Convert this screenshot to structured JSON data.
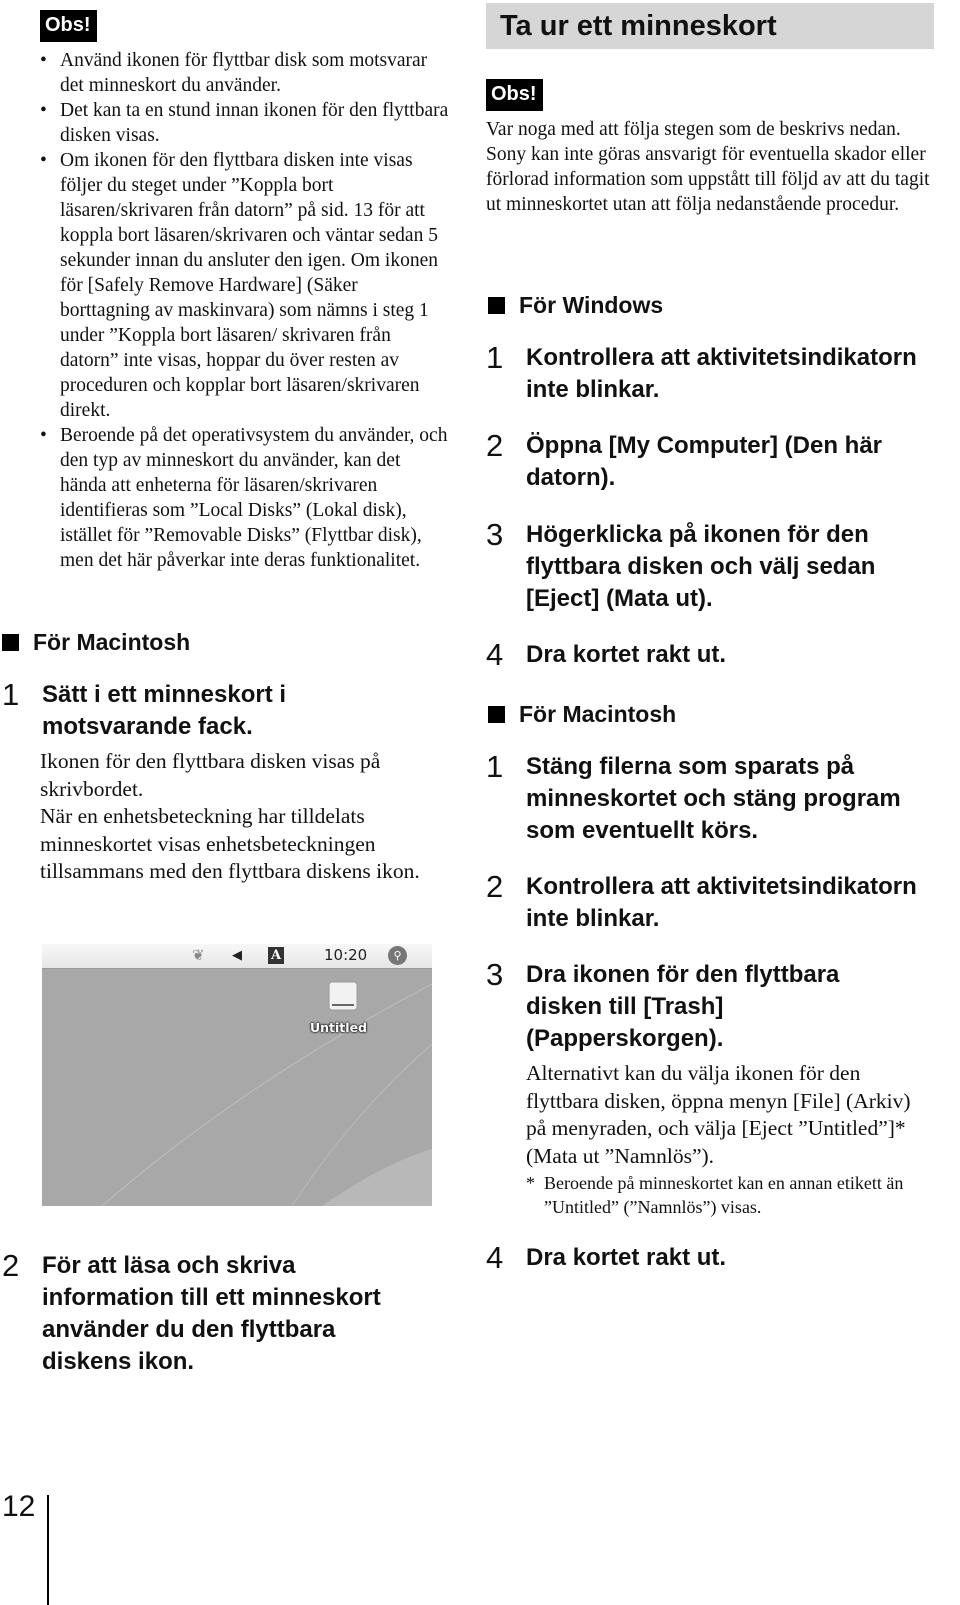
{
  "left": {
    "obs_label": "Obs!",
    "bullets": [
      "Använd ikonen för flyttbar disk som motsvarar det minneskort du använder.",
      "Det kan ta en stund innan ikonen för den flyttbara disken visas.",
      "Om ikonen för den flyttbara disken inte visas följer du steget under ”Koppla bort läsaren/skrivaren från datorn” på sid. 13 för att koppla bort läsaren/skrivaren och väntar sedan 5 sekunder innan du ansluter den igen. Om ikonen för [Safely Remove Hardware] (Säker borttagning av maskinvara) som nämns i steg 1 under ”Koppla bort läsaren/ skrivaren från datorn” inte visas, hoppar du över resten av proceduren och kopplar bort läsaren/skrivaren direkt.",
      "Beroende på det operativsystem du använder, och den typ av minneskort du använder, kan det hända att enheterna för läsaren/skrivaren identifieras som ”Local Disks” (Lokal disk), istället för ”Removable Disks” (Flyttbar disk), men det här påverkar inte deras funktionalitet."
    ],
    "mac_heading": "För Macintosh",
    "steps": [
      {
        "num": "1",
        "text": "Sätt i ett minneskort i motsvarande fack.",
        "body": "Ikonen för den flyttbara disken visas på skrivbordet.\nNär en enhetsbeteckning har tilldelats minneskortet visas enhetsbeteckningen tillsammans med den flyttbara diskens ikon."
      },
      {
        "num": "2",
        "text": "För att läsa och skriva information till ett minneskort använder du den flyttbara diskens ikon."
      }
    ],
    "screenshot": {
      "menubar_time": "10:20",
      "drive_label": "Untitled"
    }
  },
  "right": {
    "title": "Ta ur ett minneskort",
    "obs_label": "Obs!",
    "obs_text": "Var noga med att följa stegen som de beskrivs nedan.\nSony kan inte göras ansvarigt för eventuella skador eller förlorad information som uppstått till följd av att du tagit ut minneskortet utan att följa nedanstående procedur.",
    "windows_heading": "För Windows",
    "windows_steps": [
      {
        "num": "1",
        "text": "Kontrollera att aktivitetsindikatorn inte blinkar."
      },
      {
        "num": "2",
        "text": "Öppna [My Computer] (Den här datorn)."
      },
      {
        "num": "3",
        "text": "Högerklicka på ikonen för den flyttbara disken och välj sedan [Eject] (Mata ut)."
      },
      {
        "num": "4",
        "text": "Dra kortet rakt ut."
      }
    ],
    "mac_heading": "För Macintosh",
    "mac_steps": [
      {
        "num": "1",
        "text": "Stäng filerna som sparats på minneskortet och stäng program som eventuellt körs."
      },
      {
        "num": "2",
        "text": "Kontrollera att aktivitetsindikatorn inte blinkar."
      },
      {
        "num": "3",
        "text": "Dra ikonen för den flyttbara disken till [Trash] (Papperskorgen).",
        "body": "Alternativt kan du välja ikonen för den flyttbara disken, öppna menyn [File] (Arkiv) på menyraden, och välja [Eject ”Untitled”]* (Mata ut ”Namnlös”).",
        "footnote": "Beroende på minneskortet kan en annan etikett än ”Untitled” (”Namnlös”) visas."
      },
      {
        "num": "4",
        "text": "Dra kortet rakt ut."
      }
    ]
  },
  "footer": {
    "page_number": "12"
  }
}
